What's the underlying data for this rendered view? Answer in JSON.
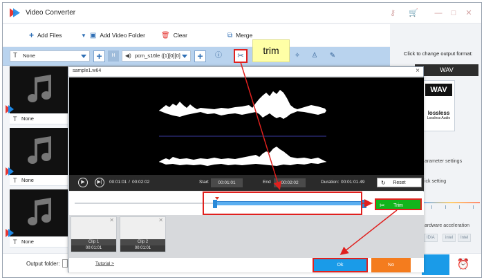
{
  "app": {
    "title": "Video Converter"
  },
  "toolbar": {
    "add_files": "Add Files",
    "add_video_folder": "Add Video Folder",
    "clear": "Clear",
    "merge": "Merge"
  },
  "options": {
    "subtitle_select": "None",
    "audio_select": "pcm_s16le ([1][0][0]",
    "hint_label": "H"
  },
  "callout": {
    "label": "trim"
  },
  "file_list": [
    {
      "subtitle": "None"
    },
    {
      "subtitle": "None"
    },
    {
      "subtitle": "None"
    }
  ],
  "right_panel": {
    "change_format_label": "Click to change output format:",
    "format_name": "WAV",
    "card_format": "WAV",
    "lossless_word": "lossless",
    "lossless_sub": "Lossless Audio",
    "parameter_settings": "arameter settings",
    "quick_setting": "ick setting",
    "hardware_accel": "ardware acceleration",
    "encoders": [
      "IDIA",
      "intel",
      "Intel"
    ]
  },
  "bottom": {
    "output_folder_label": "Output folder:"
  },
  "dialog": {
    "title": "sample1.w64",
    "close": "×",
    "current_time": "00:01:01",
    "separator": "/",
    "total_time": "00:02:02",
    "start_label": "Start",
    "start_value": "00:01:01",
    "end_label": "End",
    "end_value": "00:02:02",
    "duration_label": "Duration:",
    "duration_value": "00:01:01.49",
    "reset_label": "Reset",
    "trim_label": "Trim",
    "clips": [
      {
        "name": "Clip 1",
        "duration": "00:01:01"
      },
      {
        "name": "Clip 2",
        "duration": "00:01:01"
      }
    ],
    "tutorial_link": "Tutorial >",
    "ok_label": "Ok",
    "no_label": "No"
  },
  "timeline": {
    "selection_start_fraction": 0.47,
    "selection_end_fraction": 0.97
  },
  "colors": {
    "accent_blue": "#1a9be8",
    "trim_green": "#12b51c",
    "no_orange": "#f47c1e",
    "annotation_red": "#e0201e",
    "callout_yellow": "#ffffa6"
  },
  "icons": {
    "app_logo": "app-logo-icon",
    "trim": "scissors-icon",
    "info": "info-icon",
    "effects": "magic-wand-icon",
    "watermark": "stamp-icon",
    "edit": "pen-icon",
    "alarm": "alarm-clock-icon"
  }
}
